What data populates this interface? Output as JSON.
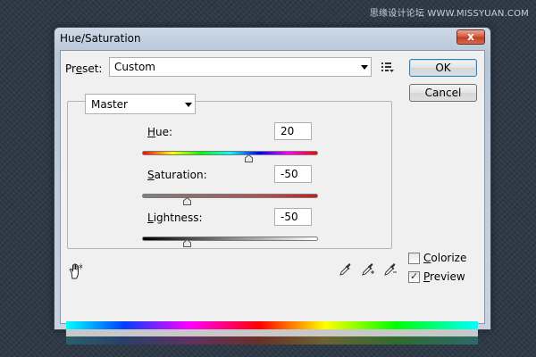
{
  "watermark": "思缘设计论坛 WWW.MISSYUAN.COM",
  "window": {
    "title": "Hue/Saturation",
    "close_label": "x"
  },
  "preset": {
    "label_underlined": "e",
    "label_prefix": "Pr",
    "label_suffix": "set:",
    "value": "Custom"
  },
  "buttons": {
    "ok": "OK",
    "cancel": "Cancel"
  },
  "channel": {
    "value": "Master"
  },
  "adjustments": {
    "hue": {
      "label_u": "H",
      "label_rest": "ue:",
      "value": "20",
      "min": -180,
      "max": 180
    },
    "saturation": {
      "label_u": "S",
      "label_rest": "aturation:",
      "value": "-50",
      "min": -100,
      "max": 100
    },
    "lightness": {
      "label_u": "L",
      "label_rest": "ightness:",
      "value": "-50",
      "min": -100,
      "max": 100
    }
  },
  "options": {
    "colorize": {
      "label_u": "C",
      "label_rest": "olorize",
      "checked": false
    },
    "preview": {
      "label_u": "P",
      "label_rest": "review",
      "checked": true,
      "mark": "✓"
    }
  },
  "icons": {
    "hand": "on-image-adjustment-hand-icon",
    "eyedropper": "eyedropper-icon",
    "eyedropper_plus": "eyedropper-plus-icon",
    "eyedropper_minus": "eyedropper-minus-icon",
    "preset_menu": "preset-options-icon"
  },
  "colors": {
    "close_button": "#d3553a",
    "ok_border": "#3c7fb1"
  }
}
